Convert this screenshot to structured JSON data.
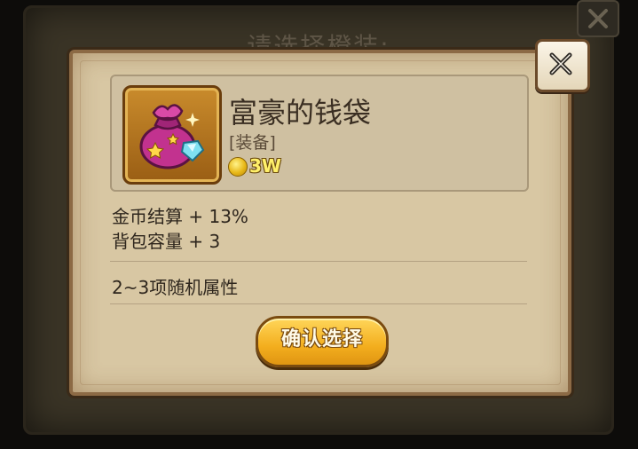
{
  "background_dialog": {
    "title": "请选择橙装:"
  },
  "item": {
    "name": "富豪的钱袋",
    "type": "[装备]",
    "price": "3W",
    "icon": "money-bag-icon"
  },
  "attributes": [
    "金币结算 + 13%",
    "背包容量 + 3"
  ],
  "random_attributes": "2~3项随机属性",
  "confirm_label": "确认选择",
  "colors": {
    "parchment": "#d8c7a3",
    "frame": "#8c6a45",
    "button": "#f3ae1e",
    "price_text": "#fff06a"
  }
}
